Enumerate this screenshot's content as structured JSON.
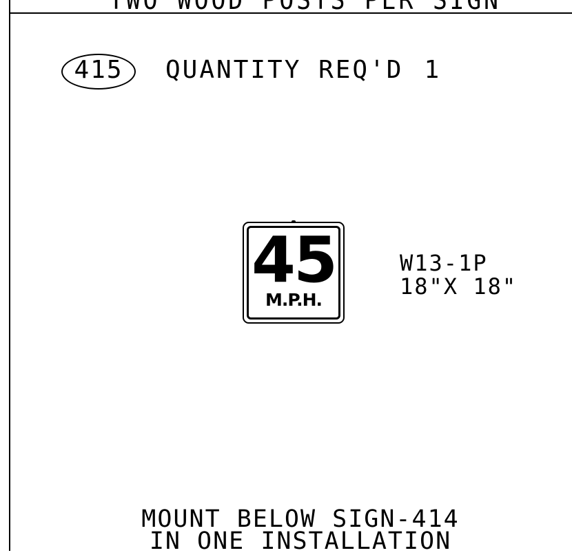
{
  "header": {
    "text": "TWO WOOD POSTS PER SIGN"
  },
  "callout": {
    "number": "415"
  },
  "quantity": {
    "label": "QUANTITY REQ'D",
    "value": "1"
  },
  "sign": {
    "speed": "45",
    "unit": "M.P.H.",
    "code": "W13-1P",
    "size": "18\"X 18\""
  },
  "note": {
    "line1": "MOUNT BELOW SIGN-414",
    "line2": "IN ONE INSTALLATION"
  }
}
